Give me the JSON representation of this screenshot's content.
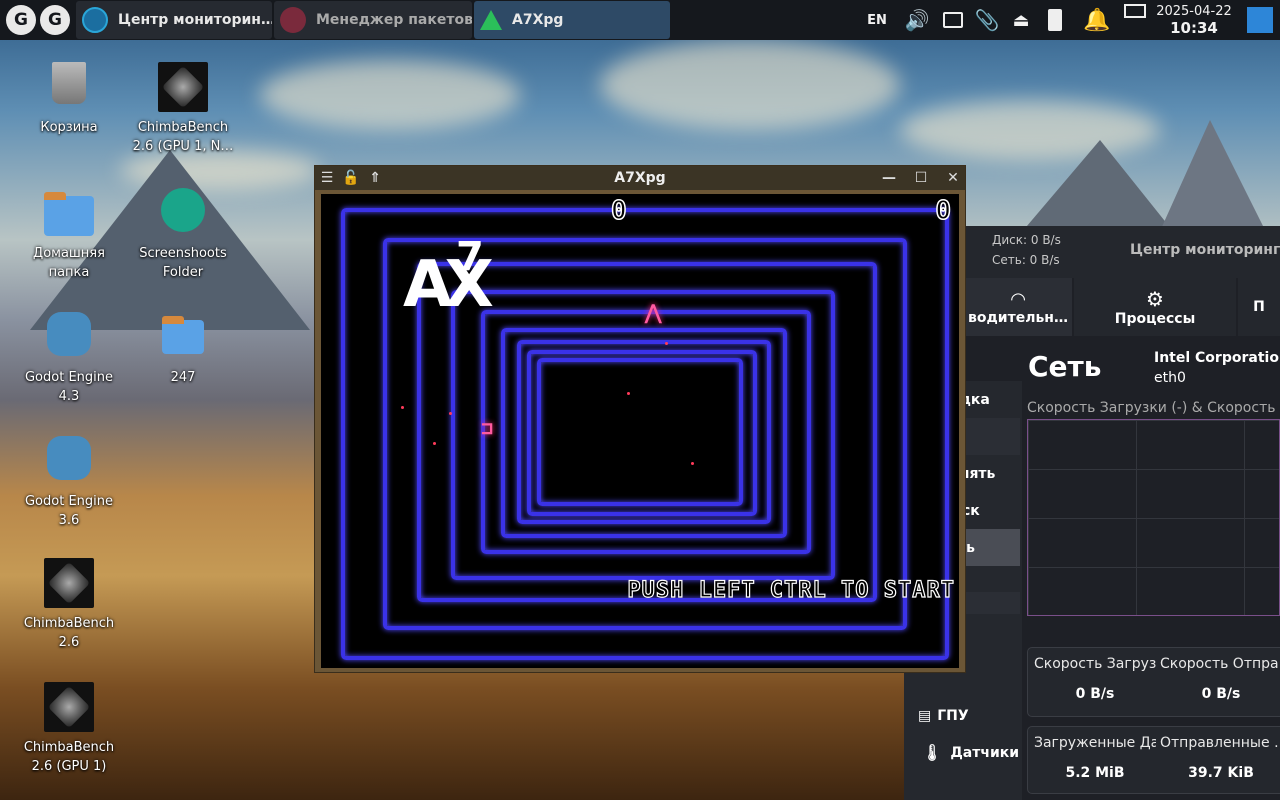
{
  "taskbar": {
    "logo": "G",
    "tasks": [
      {
        "label": "Центр мониторин…",
        "icon": "monitor-icon",
        "color": "#2aa6d8"
      },
      {
        "label": "Менеджер пакетов…",
        "icon": "download-icon",
        "color": "#a33b52"
      },
      {
        "label": "A7Xpg",
        "icon": "a7xpg-icon",
        "color": "#2bbf5a"
      }
    ],
    "lang": "EN",
    "date": "2025-04-22",
    "time": "10:34"
  },
  "desktop": {
    "icons": [
      {
        "label": "Корзина",
        "icon": "trash-icon"
      },
      {
        "label": "ChimbaBench 2.6 (GPU 1, N…",
        "icon": "chimbabench-icon"
      },
      {
        "label": "Домашняя папка",
        "icon": "home-folder-icon"
      },
      {
        "label": "Screenshoots Folder",
        "icon": "screenshot-folder-icon"
      },
      {
        "label": "Godot Engine 4.3",
        "icon": "godot-icon"
      },
      {
        "label": "247",
        "icon": "folder-icon"
      },
      {
        "label": "Godot Engine 3.6",
        "icon": "godot-icon"
      },
      {
        "label": "ChimbaBench 2.6",
        "icon": "chimbabench-icon"
      },
      {
        "label": "ChimbaBench 2.6 (GPU 1)",
        "icon": "chimbabench-icon"
      }
    ]
  },
  "game": {
    "title": "A7Xpg",
    "score_left": "0",
    "score_right": "0",
    "logo_main": "AX",
    "logo_sup": "7",
    "prompt": "PUSH LEFT CTRL TO START",
    "colors": {
      "ring": "#3a32e8",
      "ship": "#ff5aa0"
    }
  },
  "monitor": {
    "title": "Центр мониторинга",
    "disk": "Диск: 0 B/s",
    "net": "Сеть: 0 B/s",
    "tabs": [
      {
        "label": "водительн…",
        "icon": "gauge-icon"
      },
      {
        "label": "Процессы",
        "icon": "gear-icon"
      },
      {
        "label": "П",
        "icon": ""
      }
    ],
    "side": [
      "одка",
      "мять",
      "ск",
      "ть",
      "ГПУ",
      "Датчики"
    ],
    "heading": "Сеть",
    "adapter": "Intel Corporation",
    "iface": "eth0",
    "graph_title": "Скорость Загрузки (-) & Скорость Отп",
    "cards": [
      {
        "l1": "Скорость Загруз…",
        "v1": "0 B/s",
        "l2": "Скорость Отпра…",
        "v2": "0 B/s"
      },
      {
        "l1": "Загруженные Да…",
        "v1": "5.2 MiB",
        "l2": "Отправленные …",
        "v2": "39.7 KiB"
      }
    ]
  }
}
